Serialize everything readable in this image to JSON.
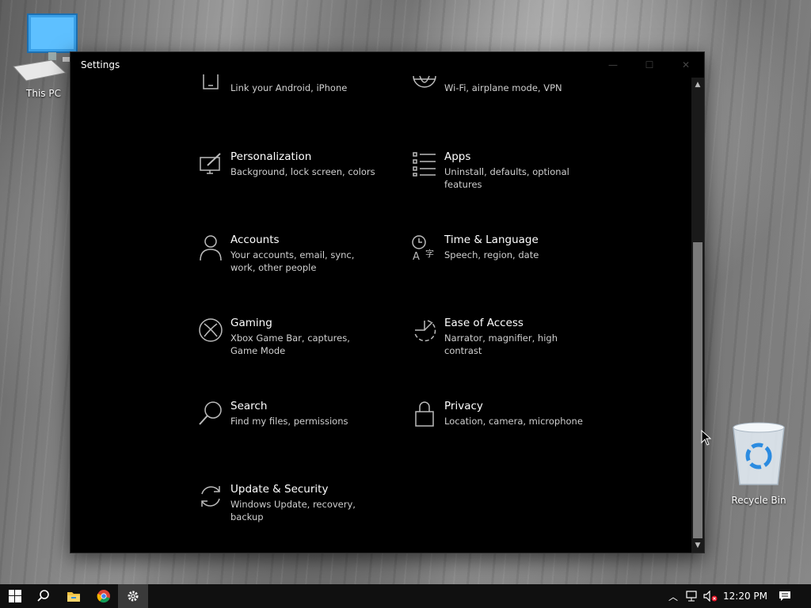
{
  "desktop": {
    "this_pc_label": "This PC",
    "recycle_bin_label": "Recycle Bin"
  },
  "window": {
    "title": "Settings",
    "minimize_icon": "minimize-icon",
    "maximize_icon": "maximize-icon",
    "close_icon": "close-icon"
  },
  "settings": {
    "partial_top": [
      {
        "desc": "Link your Android, iPhone",
        "icon": "phone-icon"
      },
      {
        "desc": "Wi-Fi, airplane mode, VPN",
        "icon": "globe-icon"
      }
    ],
    "items": [
      {
        "name": "Personalization",
        "desc": "Background, lock screen, colors",
        "icon": "personalization-icon"
      },
      {
        "name": "Apps",
        "desc": "Uninstall, defaults, optional features",
        "icon": "apps-icon"
      },
      {
        "name": "Accounts",
        "desc": "Your accounts, email, sync, work, other people",
        "icon": "person-icon"
      },
      {
        "name": "Time & Language",
        "desc": "Speech, region, date",
        "icon": "time-language-icon"
      },
      {
        "name": "Gaming",
        "desc": "Xbox Game Bar, captures, Game Mode",
        "icon": "xbox-icon"
      },
      {
        "name": "Ease of Access",
        "desc": "Narrator, magnifier, high contrast",
        "icon": "ease-of-access-icon"
      },
      {
        "name": "Search",
        "desc": "Find my files, permissions",
        "icon": "search-icon"
      },
      {
        "name": "Privacy",
        "desc": "Location, camera, microphone",
        "icon": "lock-icon"
      },
      {
        "name": "Update & Security",
        "desc": "Windows Update, recovery, backup",
        "icon": "update-icon"
      }
    ]
  },
  "taskbar": {
    "clock": "12:20 PM",
    "apps": [
      "windows-start-icon",
      "search-icon",
      "file-explorer-icon",
      "chrome-icon",
      "settings-gear-icon"
    ]
  }
}
